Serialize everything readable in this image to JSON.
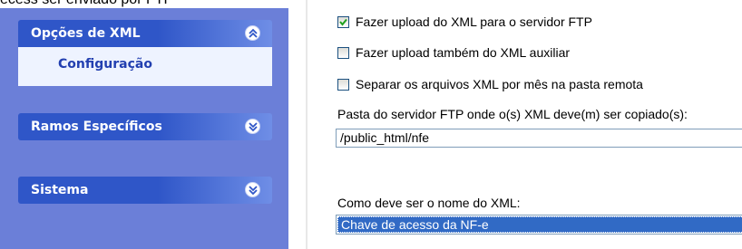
{
  "top_cut_text": "ecess ser enviado por FTP",
  "sidebar": {
    "groups": [
      {
        "title": "Opções de XML",
        "state": "expanded",
        "items": [
          "Configuração"
        ]
      },
      {
        "title": "Ramos Específicos",
        "state": "collapsed"
      },
      {
        "title": "Sistema",
        "state": "collapsed"
      }
    ]
  },
  "panel": {
    "checkboxes": [
      {
        "label": "Fazer upload do XML para o servidor FTP",
        "checked": true
      },
      {
        "label": "Fazer upload também do XML auxiliar",
        "checked": false
      },
      {
        "label": "Separar os arquivos XML por mês na pasta remota",
        "checked": false
      }
    ],
    "folder_label": "Pasta do servidor FTP onde o(s) XML deve(m) ser copiado(s):",
    "folder_value": "/public_html/nfe",
    "name_label": "Como deve ser o nome do XML:",
    "name_value": "Chave de acesso da NF-e"
  },
  "colors": {
    "sidebar_bg": "#6b7fd8",
    "header_blue": "#2f56c8",
    "selection": "#316ac5"
  }
}
